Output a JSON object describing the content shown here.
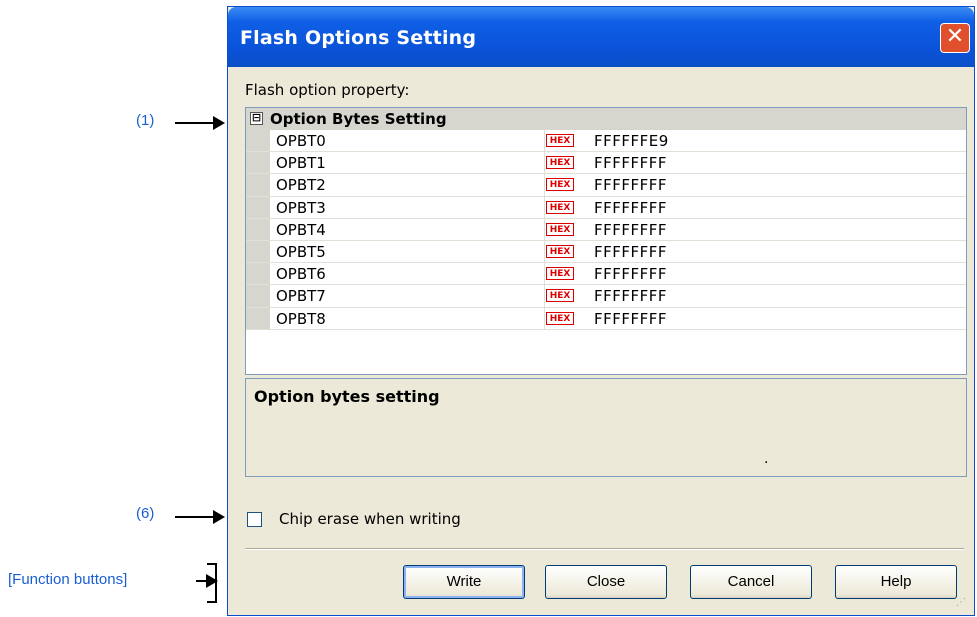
{
  "annotations": {
    "grid_callout": "(1)",
    "checkbox_callout": "(6)",
    "buttons_callout": "[Function buttons]"
  },
  "dialog": {
    "title": "Flash Options Setting",
    "close_glyph": "✕",
    "property_label": "Flash option property:",
    "category": {
      "toggle": "⊟",
      "label": "Option Bytes Setting"
    },
    "hex_badge": "HEX",
    "rows": [
      {
        "name": "OPBT0",
        "value": "FFFFFFE9"
      },
      {
        "name": "OPBT1",
        "value": "FFFFFFFF"
      },
      {
        "name": "OPBT2",
        "value": "FFFFFFFF"
      },
      {
        "name": "OPBT3",
        "value": "FFFFFFFF"
      },
      {
        "name": "OPBT4",
        "value": "FFFFFFFF"
      },
      {
        "name": "OPBT5",
        "value": "FFFFFFFF"
      },
      {
        "name": "OPBT6",
        "value": "FFFFFFFF"
      },
      {
        "name": "OPBT7",
        "value": "FFFFFFFF"
      },
      {
        "name": "OPBT8",
        "value": "FFFFFFFF"
      }
    ],
    "description": {
      "title": "Option bytes setting",
      "dot": "."
    },
    "checkbox": {
      "label": "Chip erase when writing",
      "checked": false
    },
    "buttons": {
      "write": "Write",
      "close": "Close",
      "cancel": "Cancel",
      "help": "Help"
    }
  }
}
